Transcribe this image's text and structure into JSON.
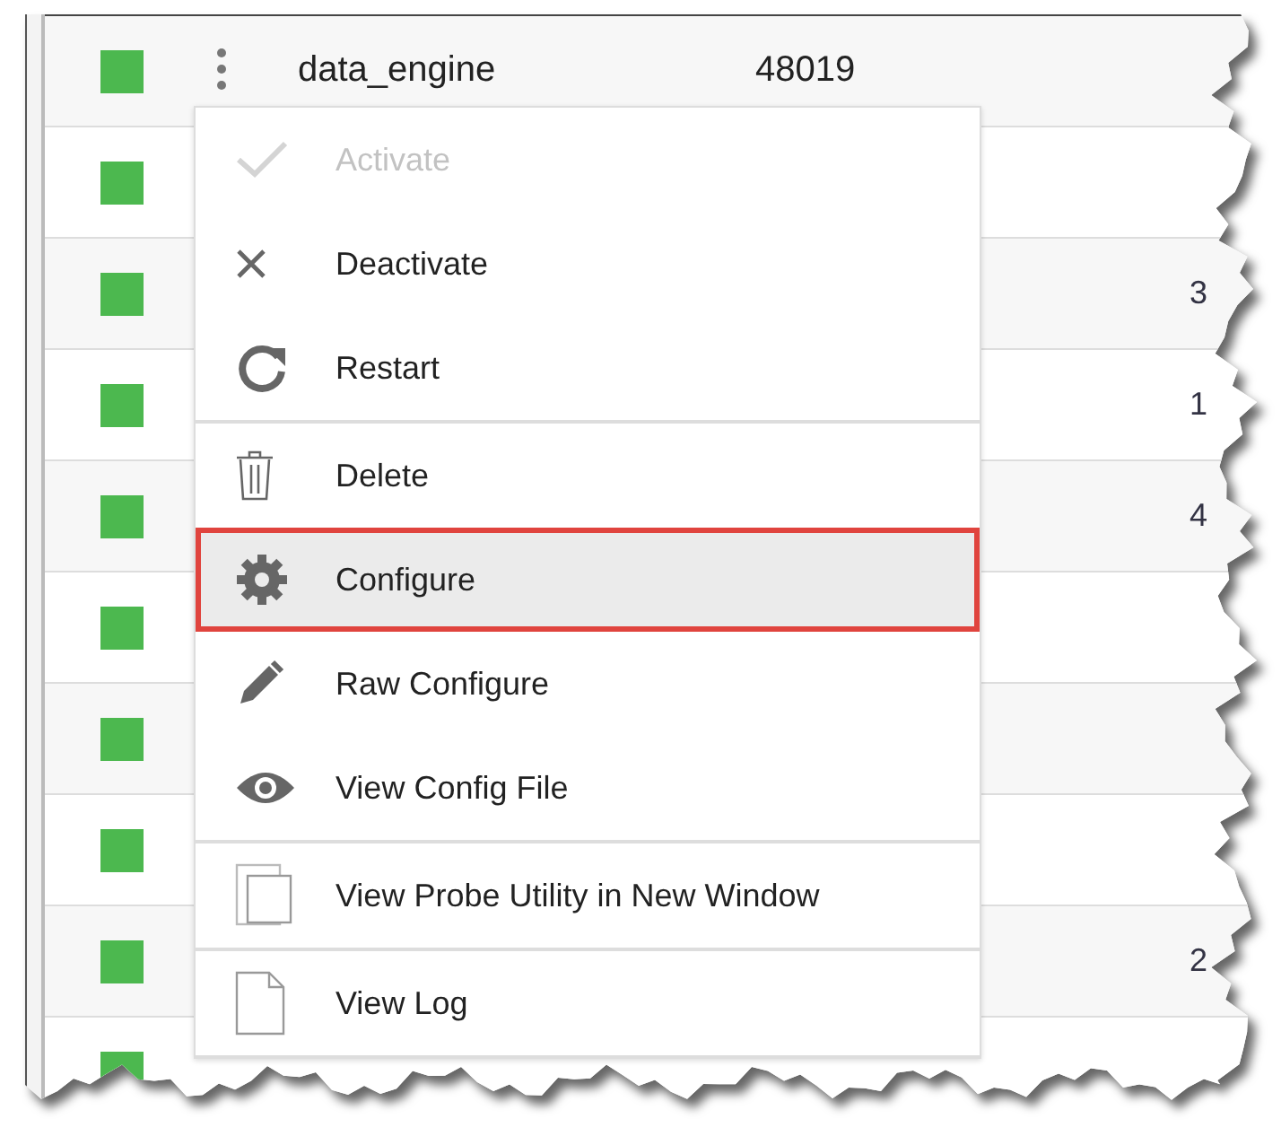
{
  "rows": [
    {
      "active": true,
      "name": "data_engine",
      "port": "48019"
    },
    {
      "active": true
    },
    {
      "active": true,
      "column_3": "3"
    },
    {
      "active": true,
      "column_3": "1"
    },
    {
      "active": true,
      "column_3": "4"
    },
    {
      "active": true
    },
    {
      "active": true
    },
    {
      "active": true
    },
    {
      "active": true,
      "column_3": "2"
    },
    {
      "active": true
    }
  ],
  "menu": {
    "groups": [
      [
        {
          "kind": "check",
          "label": "Activate",
          "disabled": true,
          "selected": false
        },
        {
          "kind": "close",
          "label": "Deactivate",
          "disabled": false,
          "selected": false
        },
        {
          "kind": "restart",
          "label": "Restart",
          "disabled": false,
          "selected": false
        }
      ],
      [
        {
          "kind": "trash",
          "label": "Delete",
          "disabled": false,
          "selected": false
        },
        {
          "kind": "gear",
          "label": "Configure",
          "disabled": false,
          "selected": true
        },
        {
          "kind": "pencil",
          "label": "Raw Configure",
          "disabled": false,
          "selected": false
        },
        {
          "kind": "eye",
          "label": "View Config File",
          "disabled": false,
          "selected": false
        }
      ],
      [
        {
          "kind": "copy",
          "label": "View Probe Utility in New Window",
          "disabled": false,
          "selected": false
        }
      ],
      [
        {
          "kind": "file",
          "label": "View Log",
          "disabled": false,
          "selected": false
        }
      ]
    ]
  }
}
